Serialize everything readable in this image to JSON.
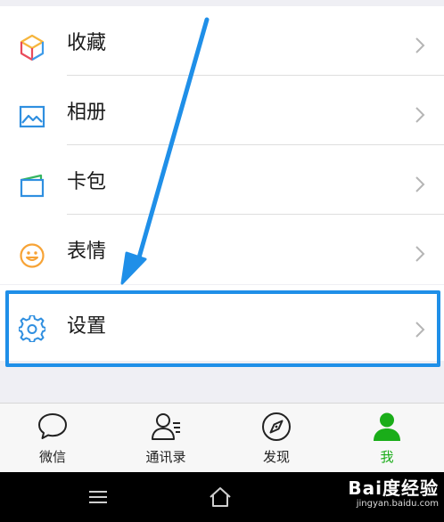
{
  "menu": {
    "items": [
      {
        "label": "收藏",
        "icon": "favorites-cube-icon"
      },
      {
        "label": "相册",
        "icon": "album-icon"
      },
      {
        "label": "卡包",
        "icon": "card-wallet-icon"
      },
      {
        "label": "表情",
        "icon": "sticker-smiley-icon"
      }
    ],
    "settings": {
      "label": "设置",
      "icon": "gear-icon"
    }
  },
  "tabbar": {
    "tabs": [
      {
        "label": "微信",
        "icon": "chat-bubble-icon"
      },
      {
        "label": "通讯录",
        "icon": "contacts-icon"
      },
      {
        "label": "发现",
        "icon": "compass-icon"
      },
      {
        "label": "我",
        "icon": "me-person-icon",
        "active": true
      }
    ]
  },
  "navbar": {
    "watermark": {
      "main": "Bai度经验",
      "sub": "jingyan.baidu.com"
    }
  },
  "colors": {
    "accent_green": "#1aad19",
    "annotation_blue": "#1f8fe8",
    "page_bg": "#efeff4"
  }
}
